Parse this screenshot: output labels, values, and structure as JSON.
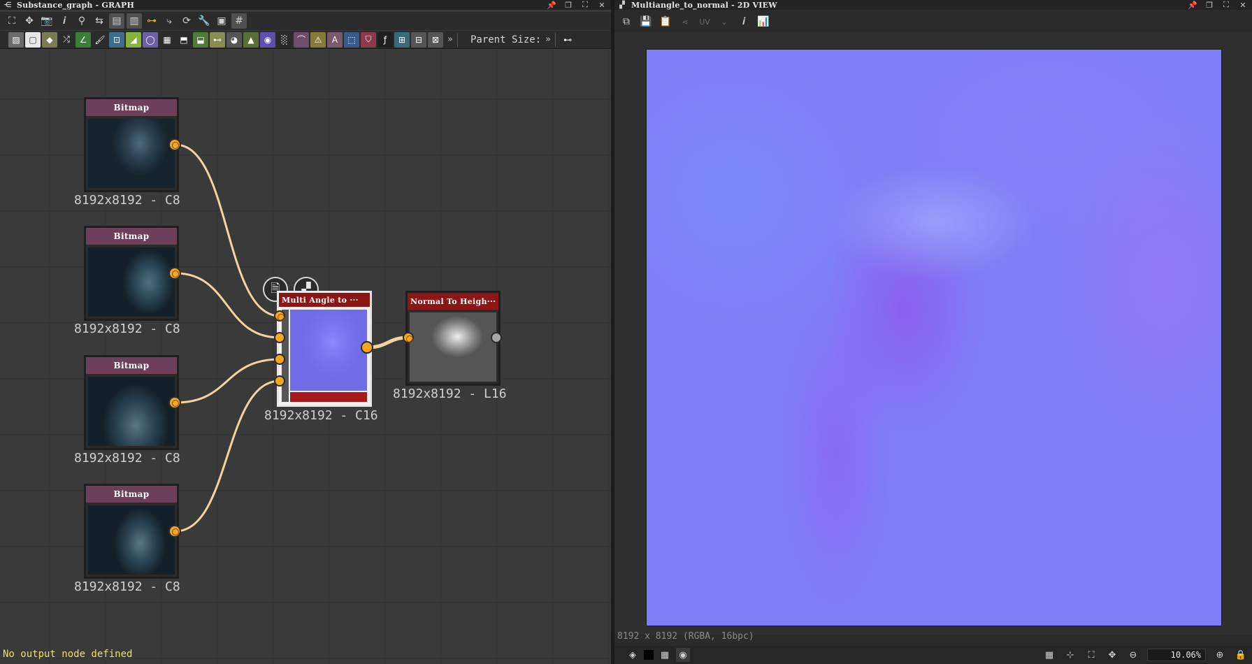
{
  "graph_panel": {
    "title": "Substance_graph - GRAPH",
    "parent_size_label": "Parent Size:",
    "status": "No output node defined"
  },
  "nodes": {
    "bitmap_1": {
      "header": "Bitmap",
      "label": "8192x8192 - C8"
    },
    "bitmap_2": {
      "header": "Bitmap",
      "label": "8192x8192 - C8"
    },
    "bitmap_3": {
      "header": "Bitmap",
      "label": "8192x8192 - C8"
    },
    "bitmap_4": {
      "header": "Bitmap",
      "label": "8192x8192 - C8"
    },
    "multi_angle": {
      "header": "Multi Angle to ···",
      "label": "8192x8192 - C16"
    },
    "normal_to_height": {
      "header": "Normal To Heigh···",
      "label": "8192x8192 - L16"
    }
  },
  "view_panel": {
    "title": "Multiangle_to_normal - 2D VIEW",
    "uv_label": "UV",
    "image_info": "8192 x 8192 (RGBA, 16bpc)",
    "zoom": "10.06%"
  },
  "colors": {
    "node_output_port": "#f5a623",
    "wire": "#f3d3a0",
    "bitmap_header": "#6d3f5b",
    "filter_header": "#8c1515",
    "status_text": "#e8e06a",
    "normal_map_base": "#7f7ef6"
  }
}
